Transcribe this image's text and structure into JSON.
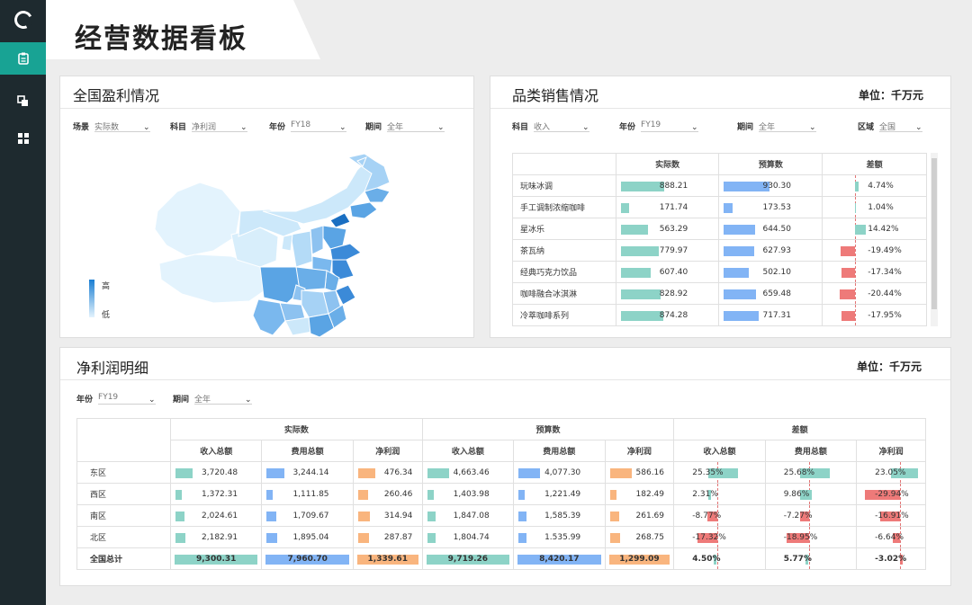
{
  "header": {
    "title": "经营数据看板"
  },
  "colors": {
    "accent": "#18a394",
    "teal": "#8dd3c7",
    "blue": "#82b4f5",
    "orange": "#f9b57e",
    "red": "#ee7a79",
    "sidebar": "#1e2a2f"
  },
  "sidebar": {
    "items": [
      {
        "icon": "clipboard-icon",
        "active": true
      },
      {
        "icon": "copy-icon",
        "active": false
      },
      {
        "icon": "grid-icon",
        "active": false
      }
    ]
  },
  "profit_panel": {
    "title": "全国盈利情况",
    "filters": [
      {
        "label": "场景",
        "value": "实际数"
      },
      {
        "label": "科目",
        "value": "净利润"
      },
      {
        "label": "年份",
        "value": "FY18"
      },
      {
        "label": "期间",
        "value": "全年"
      }
    ],
    "legend": {
      "high": "高",
      "low": "低"
    }
  },
  "category_panel": {
    "title": "品类销售情况",
    "unit": "单位：千万元",
    "filters": [
      {
        "label": "科目",
        "value": "收入"
      },
      {
        "label": "年份",
        "value": "FY19"
      },
      {
        "label": "期间",
        "value": "全年"
      },
      {
        "label": "区域",
        "value": "全国"
      }
    ],
    "columns": [
      "实际数",
      "预算数",
      "差额"
    ],
    "rows": [
      {
        "name": "玩味冰调",
        "actual": "888.21",
        "actual_v": 888.21,
        "budget": "930.30",
        "budget_v": 930.3,
        "diff": "4.74%",
        "diff_v": 4.74
      },
      {
        "name": "手工调制浓缩咖啡",
        "actual": "171.74",
        "actual_v": 171.74,
        "budget": "173.53",
        "budget_v": 173.53,
        "diff": "1.04%",
        "diff_v": 1.04
      },
      {
        "name": "星冰乐",
        "actual": "563.29",
        "actual_v": 563.29,
        "budget": "644.50",
        "budget_v": 644.5,
        "diff": "14.42%",
        "diff_v": 14.42
      },
      {
        "name": "茶瓦纳",
        "actual": "779.97",
        "actual_v": 779.97,
        "budget": "627.93",
        "budget_v": 627.93,
        "diff": "-19.49%",
        "diff_v": -19.49
      },
      {
        "name": "经典巧克力饮品",
        "actual": "607.40",
        "actual_v": 607.4,
        "budget": "502.10",
        "budget_v": 502.1,
        "diff": "-17.34%",
        "diff_v": -17.34
      },
      {
        "name": "咖啡融合冰淇淋",
        "actual": "828.92",
        "actual_v": 828.92,
        "budget": "659.48",
        "budget_v": 659.48,
        "diff": "-20.44%",
        "diff_v": -20.44
      },
      {
        "name": "冷萃咖啡系列",
        "actual": "874.28",
        "actual_v": 874.28,
        "budget": "717.31",
        "budget_v": 717.31,
        "diff": "-17.95%",
        "diff_v": -17.95
      }
    ]
  },
  "net_panel": {
    "title": "净利润明细",
    "unit": "单位：千万元",
    "filters": [
      {
        "label": "年份",
        "value": "FY19"
      },
      {
        "label": "期间",
        "value": "全年"
      }
    ],
    "groups": [
      "实际数",
      "预算数",
      "差额"
    ],
    "subcols": [
      "收入总额",
      "费用总额",
      "净利润",
      "收入总额",
      "费用总额",
      "净利润",
      "收入总额",
      "费用总额",
      "净利润"
    ],
    "rows": [
      {
        "name": "东区",
        "cells": [
          {
            "t": "3,720.48",
            "v": 3720.48
          },
          {
            "t": "3,244.14",
            "v": 3244.14
          },
          {
            "t": "476.34",
            "v": 476.34
          },
          {
            "t": "4,663.46",
            "v": 4663.46
          },
          {
            "t": "4,077.30",
            "v": 4077.3
          },
          {
            "t": "586.16",
            "v": 586.16
          },
          {
            "t": "25.35%",
            "v": 25.35
          },
          {
            "t": "25.68%",
            "v": 25.68
          },
          {
            "t": "23.05%",
            "v": 23.05
          }
        ]
      },
      {
        "name": "西区",
        "cells": [
          {
            "t": "1,372.31",
            "v": 1372.31
          },
          {
            "t": "1,111.85",
            "v": 1111.85
          },
          {
            "t": "260.46",
            "v": 260.46
          },
          {
            "t": "1,403.98",
            "v": 1403.98
          },
          {
            "t": "1,221.49",
            "v": 1221.49
          },
          {
            "t": "182.49",
            "v": 182.49
          },
          {
            "t": "2.31%",
            "v": 2.31
          },
          {
            "t": "9.86%",
            "v": 9.86
          },
          {
            "t": "-29.94%",
            "v": -29.94
          }
        ]
      },
      {
        "name": "南区",
        "cells": [
          {
            "t": "2,024.61",
            "v": 2024.61
          },
          {
            "t": "1,709.67",
            "v": 1709.67
          },
          {
            "t": "314.94",
            "v": 314.94
          },
          {
            "t": "1,847.08",
            "v": 1847.08
          },
          {
            "t": "1,585.39",
            "v": 1585.39
          },
          {
            "t": "261.69",
            "v": 261.69
          },
          {
            "t": "-8.77%",
            "v": -8.77
          },
          {
            "t": "-7.27%",
            "v": -7.27
          },
          {
            "t": "-16.91%",
            "v": -16.91
          }
        ]
      },
      {
        "name": "北区",
        "cells": [
          {
            "t": "2,182.91",
            "v": 2182.91
          },
          {
            "t": "1,895.04",
            "v": 1895.04
          },
          {
            "t": "287.87",
            "v": 287.87
          },
          {
            "t": "1,804.74",
            "v": 1804.74
          },
          {
            "t": "1.535.99",
            "v": 1535.99
          },
          {
            "t": "268.75",
            "v": 268.75
          },
          {
            "t": "-17.32%",
            "v": -17.32
          },
          {
            "t": "-18.95%",
            "v": -18.95
          },
          {
            "t": "-6.64%",
            "v": -6.64
          }
        ]
      }
    ],
    "total": {
      "name": "全国总计",
      "cells": [
        {
          "t": "9,300.31"
        },
        {
          "t": "7,960.70"
        },
        {
          "t": "1,339.61"
        },
        {
          "t": "9,719.26"
        },
        {
          "t": "8,420.17"
        },
        {
          "t": "1,299.09"
        },
        {
          "t": "4.50%",
          "v": 4.5
        },
        {
          "t": "5.77%",
          "v": 5.77
        },
        {
          "t": "-3.02%",
          "v": -3.02
        }
      ]
    }
  }
}
